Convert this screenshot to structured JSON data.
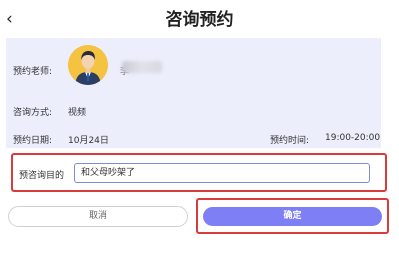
{
  "header": {
    "back_icon": "chevron-left-icon",
    "back_glyph": "‹",
    "title": "咨询预约"
  },
  "info": {
    "teacher_label": "预约老师:",
    "teacher_name_partial": "李",
    "method_label": "咨询方式:",
    "method_value": "视频",
    "date_label": "预约日期:",
    "date_value": "10月24日",
    "time_label": "预约时间:",
    "time_value": "19:00-20:00"
  },
  "purpose": {
    "label": "预咨询目的",
    "value": "和父母吵架了"
  },
  "actions": {
    "cancel_label": "取消",
    "confirm_label": "确定"
  },
  "colors": {
    "card_bg": "#eceefc",
    "confirm_bg": "#7f7ff5",
    "highlight": "#d93a3a",
    "avatar_bg": "#f4c341"
  }
}
